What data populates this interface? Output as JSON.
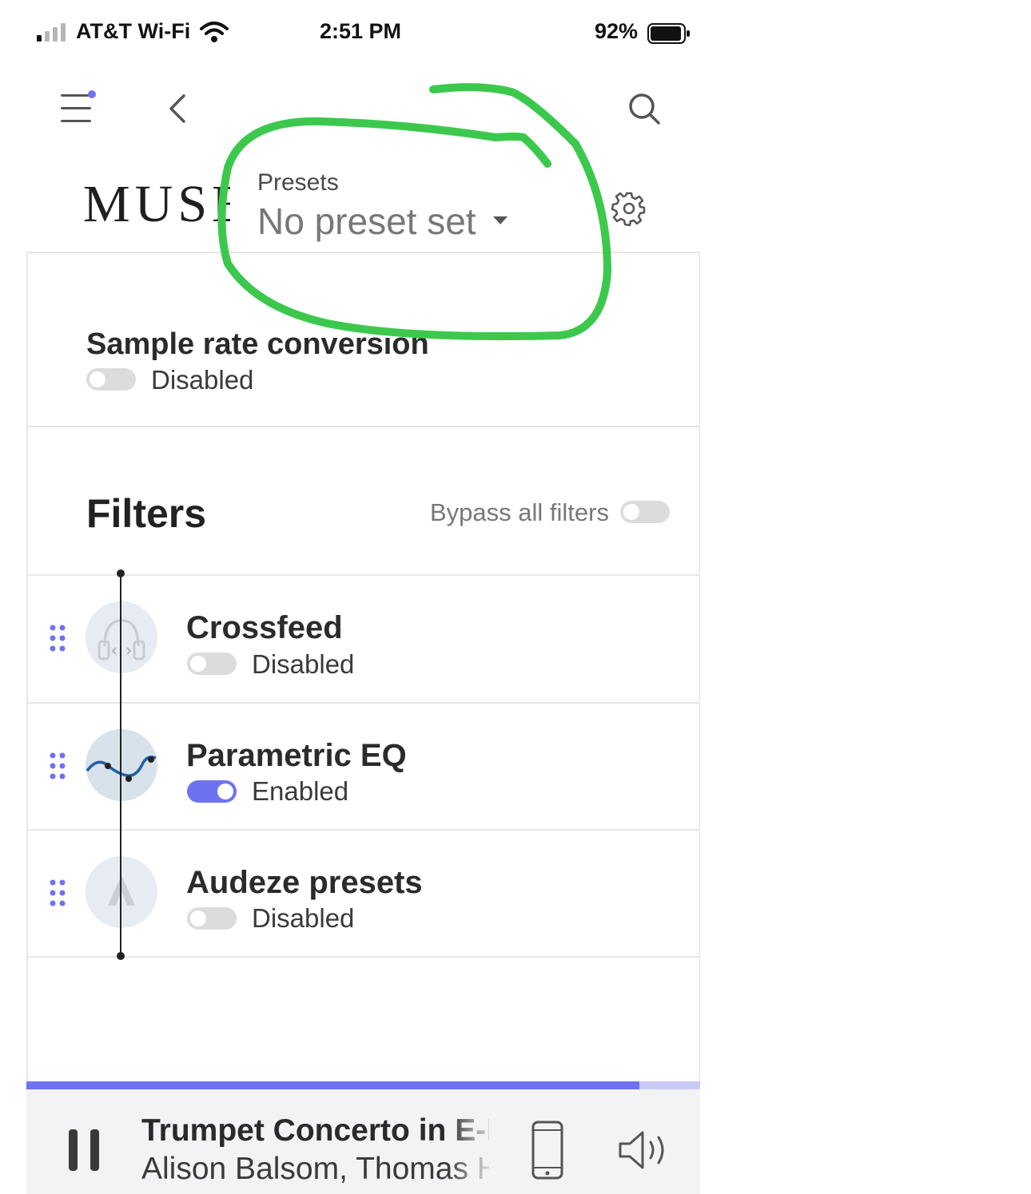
{
  "status_bar": {
    "carrier": "AT&T Wi-Fi",
    "time": "2:51 PM",
    "battery": "92%"
  },
  "header": {
    "brand": "MUSE",
    "presets_label": "Presets",
    "presets_value": "No preset set"
  },
  "sample_rate": {
    "title": "Sample rate conversion",
    "state": "Disabled",
    "enabled": false
  },
  "filters": {
    "title": "Filters",
    "bypass_label": "Bypass all filters",
    "bypass_enabled": false,
    "items": [
      {
        "name": "Crossfeed",
        "state": "Disabled",
        "enabled": false,
        "icon": "headphones-icon"
      },
      {
        "name": "Parametric EQ",
        "state": "Enabled",
        "enabled": true,
        "icon": "eq-curve-icon"
      },
      {
        "name": "Audeze presets",
        "state": "Disabled",
        "enabled": false,
        "icon": "audeze-logo-icon"
      }
    ]
  },
  "player": {
    "track_title": "Trumpet Concerto in E-Flat",
    "track_artist": "Alison Balsom, Thomas Hengelbrock",
    "progress": 0.91
  },
  "colors": {
    "accent": "#6f72f0",
    "annotation": "#3cc84c"
  }
}
